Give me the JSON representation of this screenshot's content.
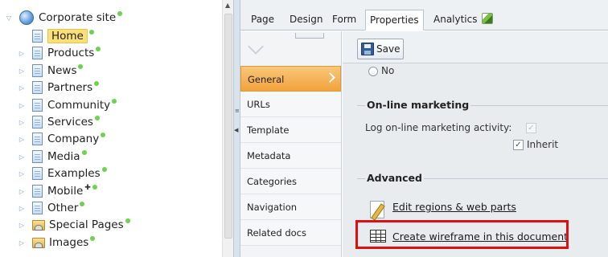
{
  "tree": {
    "root": "Corporate site",
    "items": [
      {
        "label": "Home",
        "kind": "page",
        "expander": false,
        "dot": true,
        "highlight": true
      },
      {
        "label": "Products",
        "kind": "page",
        "expander": true,
        "dot": true
      },
      {
        "label": "News",
        "kind": "page",
        "expander": true,
        "dot": true
      },
      {
        "label": "Partners",
        "kind": "page",
        "expander": true,
        "dot": true
      },
      {
        "label": "Community",
        "kind": "page",
        "expander": true,
        "dot": true
      },
      {
        "label": "Services",
        "kind": "page",
        "expander": true,
        "dot": true
      },
      {
        "label": "Company",
        "kind": "page",
        "expander": true,
        "dot": true
      },
      {
        "label": "Media",
        "kind": "page",
        "expander": true,
        "dot": true
      },
      {
        "label": "Examples",
        "kind": "page",
        "expander": true,
        "dot": true
      },
      {
        "label": "Mobile",
        "kind": "page",
        "expander": true,
        "dot": true,
        "star": true
      },
      {
        "label": "Other",
        "kind": "page",
        "expander": true,
        "dot": true
      },
      {
        "label": "Special Pages",
        "kind": "folder",
        "expander": true,
        "dot": true
      },
      {
        "label": "Images",
        "kind": "folder",
        "expander": true,
        "dot": true
      }
    ]
  },
  "tabs": [
    "Page",
    "Design",
    "Form",
    "Properties",
    "Analytics"
  ],
  "active_tab": "Properties",
  "vnav": {
    "items": [
      "General",
      "URLs",
      "Template",
      "Metadata",
      "Categories",
      "Navigation",
      "Related docs"
    ],
    "active": "General"
  },
  "toolbar": {
    "save_label": "Save"
  },
  "radio": {
    "no_label": "No"
  },
  "online_marketing": {
    "legend": "On-line marketing",
    "log_label": "Log on-line marketing activity:",
    "inherit_label": "Inherit",
    "checkmark": "✓"
  },
  "advanced": {
    "legend": "Advanced",
    "edit_regions_label": "Edit regions & web parts",
    "create_wireframe_label": "Create wireframe in this document"
  },
  "colors": {
    "accent": "#f2a23a",
    "highlight_box": "#e01010",
    "status_dot": "#6dd34a"
  }
}
